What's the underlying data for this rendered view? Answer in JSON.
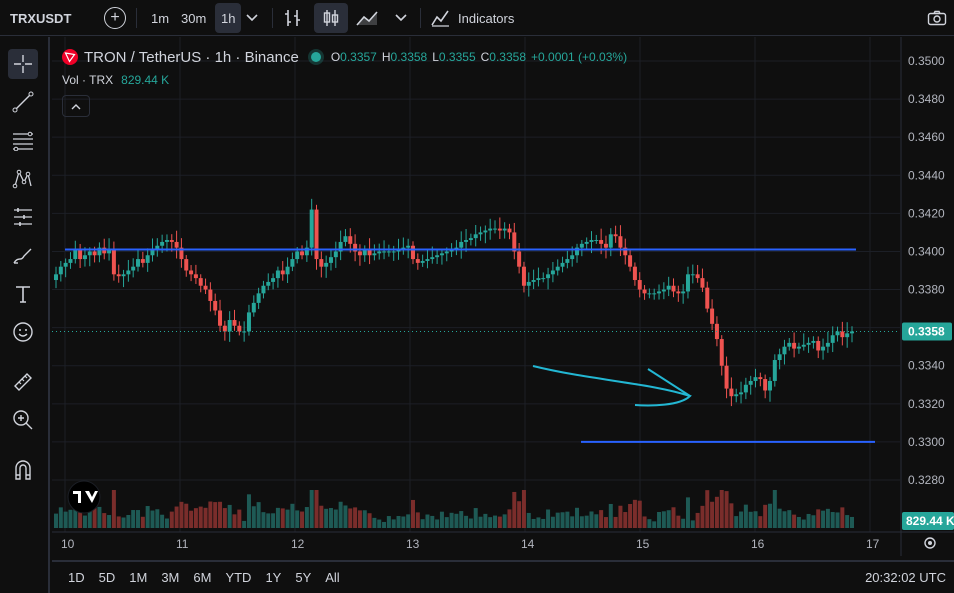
{
  "toolbar": {
    "symbol": "TRXUSDT",
    "intervals": [
      "1m",
      "30m",
      "1h"
    ],
    "active_interval": "1h",
    "indicators_label": "Indicators"
  },
  "legend": {
    "pair": "TRON / TetherUS · 1h · Binance",
    "o_label": "O",
    "o": "0.3357",
    "h_label": "H",
    "h": "0.3358",
    "l_label": "L",
    "l": "0.3355",
    "c_label": "C",
    "c": "0.3358",
    "change": "+0.0001 (+0.03%)",
    "vol_label": "Vol · TRX",
    "vol_value": "829.44 K"
  },
  "colors": {
    "up": "#26a69a",
    "down": "#ef5350",
    "vol_up": "#1e5a55",
    "vol_down": "#7a2d2b",
    "hline": "#2962ff",
    "drawing": "#23b7d3",
    "bg": "#0f0f0f"
  },
  "price_axis": {
    "ticks": [
      "0.3500",
      "0.3480",
      "0.3460",
      "0.3440",
      "0.3420",
      "0.3400",
      "0.3380",
      "0.3360",
      "0.3340",
      "0.3320",
      "0.3300",
      "0.3280"
    ],
    "last_price_label": "0.3358",
    "volume_label": "829.44 K"
  },
  "time_axis": {
    "ticks": [
      "10",
      "11",
      "12",
      "13",
      "14",
      "15",
      "16",
      "17"
    ]
  },
  "bottom": {
    "ranges": [
      "1D",
      "5D",
      "1M",
      "3M",
      "6M",
      "YTD",
      "1Y",
      "5Y",
      "All"
    ],
    "clock": "20:32:02 UTC"
  },
  "chart_data": {
    "type": "candlestick",
    "title": "TRON / TetherUS · 1h · Binance",
    "x_unit": "hour",
    "ylim": [
      0.3272,
      0.3504
    ],
    "x_start_day": "10",
    "series_close": [
      0.3388,
      0.3392,
      0.3394,
      0.3396,
      0.3401,
      0.3396,
      0.3398,
      0.34,
      0.3398,
      0.3402,
      0.3399,
      0.3401,
      0.3388,
      0.3387,
      0.3388,
      0.339,
      0.3392,
      0.3396,
      0.3394,
      0.3398,
      0.3401,
      0.3403,
      0.3405,
      0.3406,
      0.3405,
      0.3402,
      0.3396,
      0.339,
      0.3388,
      0.3386,
      0.3382,
      0.338,
      0.3374,
      0.3369,
      0.3361,
      0.3358,
      0.3364,
      0.3361,
      0.3358,
      0.3358,
      0.3368,
      0.3373,
      0.3378,
      0.3382,
      0.3384,
      0.3386,
      0.339,
      0.3388,
      0.3392,
      0.3396,
      0.34,
      0.3398,
      0.3402,
      0.3422,
      0.3396,
      0.3392,
      0.3394,
      0.3397,
      0.34,
      0.3405,
      0.3408,
      0.3404,
      0.34,
      0.3398,
      0.3401,
      0.3398,
      0.3399,
      0.34,
      0.34,
      0.34,
      0.34,
      0.3401,
      0.3402,
      0.3403,
      0.3396,
      0.3394,
      0.3395,
      0.3396,
      0.3397,
      0.3398,
      0.3399,
      0.34,
      0.3401,
      0.3402,
      0.3405,
      0.3406,
      0.3407,
      0.3409,
      0.341,
      0.3411,
      0.3412,
      0.3412,
      0.3411,
      0.3412,
      0.341,
      0.34,
      0.3392,
      0.3382,
      0.3384,
      0.3385,
      0.3386,
      0.3386,
      0.3388,
      0.339,
      0.3392,
      0.3394,
      0.3396,
      0.3398,
      0.3402,
      0.3404,
      0.3405,
      0.3406,
      0.3406,
      0.3404,
      0.3402,
      0.3409,
      0.3408,
      0.3402,
      0.3398,
      0.3392,
      0.3385,
      0.338,
      0.3378,
      0.3378,
      0.3378,
      0.3379,
      0.338,
      0.3382,
      0.3379,
      0.3378,
      0.3379,
      0.3388,
      0.3388,
      0.3386,
      0.3381,
      0.337,
      0.3362,
      0.3354,
      0.334,
      0.3328,
      0.3324,
      0.3325,
      0.3326,
      0.333,
      0.3332,
      0.3334,
      0.3333,
      0.3327,
      0.3332,
      0.3343,
      0.3346,
      0.335,
      0.3352,
      0.3349,
      0.335,
      0.3351,
      0.3352,
      0.3353,
      0.3348,
      0.335,
      0.3352,
      0.3356,
      0.3358,
      0.3355,
      0.3357,
      0.3358
    ],
    "last_price": 0.3358,
    "last_volume": "829.44 K",
    "annotations": [
      {
        "type": "hline",
        "price": 0.3401
      },
      {
        "type": "hline",
        "price": 0.33
      },
      {
        "type": "arrow-drawing"
      }
    ]
  }
}
